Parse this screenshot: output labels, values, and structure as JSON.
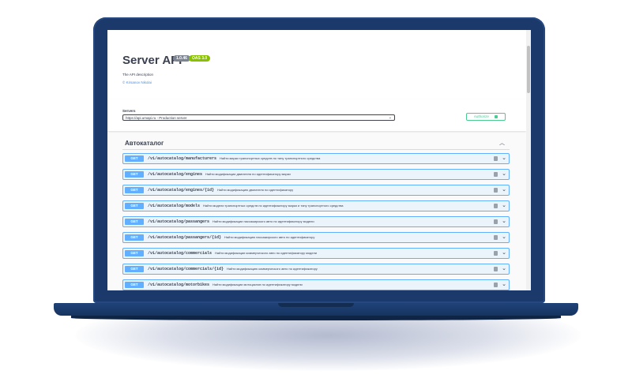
{
  "info": {
    "title": "Server API",
    "version": "1.0.46",
    "oas": "OAS 3.0",
    "description": "The API description",
    "contact": "© Kirsanov Nikolai"
  },
  "servers": {
    "label": "Servers",
    "selected": "https://api.umapi.ru - Production server",
    "authorize_label": "Authorize"
  },
  "tag": {
    "name": "Автокаталог"
  },
  "operations": [
    {
      "method": "GET",
      "path": "/v1/autocatalog/manufacturers",
      "summary": "Найти марки транспортных средств по типу транспортного средства"
    },
    {
      "method": "GET",
      "path": "/v1/autocatalog/engines",
      "summary": "Найти модификации двигателя по идентификатору марки"
    },
    {
      "method": "GET",
      "path": "/v1/autocatalog/engines/{id}",
      "summary": "Найти модификацию двигателя по идентификатору"
    },
    {
      "method": "GET",
      "path": "/v1/autocatalog/models",
      "summary": "Найти модели транспортных средств по идентификатору марки и типу транспортного средства"
    },
    {
      "method": "GET",
      "path": "/v1/autocatalog/passangers",
      "summary": "Найти модификации пассажирского авто по идентификатору модели"
    },
    {
      "method": "GET",
      "path": "/v1/autocatalog/passangers/{id}",
      "summary": "Найти модификацию пассажирского авто по идентификатору"
    },
    {
      "method": "GET",
      "path": "/v1/autocatalog/commercials",
      "summary": "Найти модификации коммерческого авто по идентификатору модели"
    },
    {
      "method": "GET",
      "path": "/v1/autocatalog/commercials/{id}",
      "summary": "Найти модификацию коммерческого авто по идентификатору"
    },
    {
      "method": "GET",
      "path": "/v1/autocatalog/motorbikes",
      "summary": "Найти модификации мотоциклов по идентификатору модели"
    }
  ],
  "colors": {
    "get": "#61affe",
    "authorize": "#49cc90",
    "laptop": "#1b3a6b"
  },
  "icons": {
    "lock": "lock-icon",
    "chevron": "chevron-down-icon",
    "collapse": "chevron-up-icon"
  }
}
